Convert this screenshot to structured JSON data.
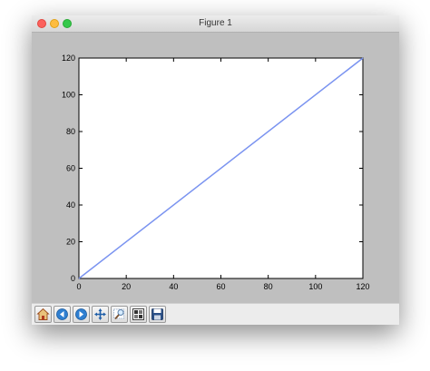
{
  "window": {
    "title": "Figure 1"
  },
  "chart_data": {
    "type": "line",
    "x": [
      0,
      120
    ],
    "series": [
      {
        "values": [
          0,
          120
        ],
        "color": "#7a93f0"
      }
    ],
    "title": "",
    "xlabel": "",
    "ylabel": "",
    "xlim": [
      0,
      120
    ],
    "ylim": [
      0,
      120
    ],
    "xticks": [
      0,
      20,
      40,
      60,
      80,
      100,
      120
    ],
    "yticks": [
      0,
      20,
      40,
      60,
      80,
      100,
      120
    ],
    "grid": false
  },
  "toolbar": {
    "buttons": [
      {
        "icon": "home-icon"
      },
      {
        "icon": "back-icon"
      },
      {
        "icon": "forward-icon"
      },
      {
        "icon": "pan-icon"
      },
      {
        "icon": "zoom-icon"
      },
      {
        "icon": "configure-subplots-icon"
      },
      {
        "icon": "save-icon"
      }
    ]
  }
}
